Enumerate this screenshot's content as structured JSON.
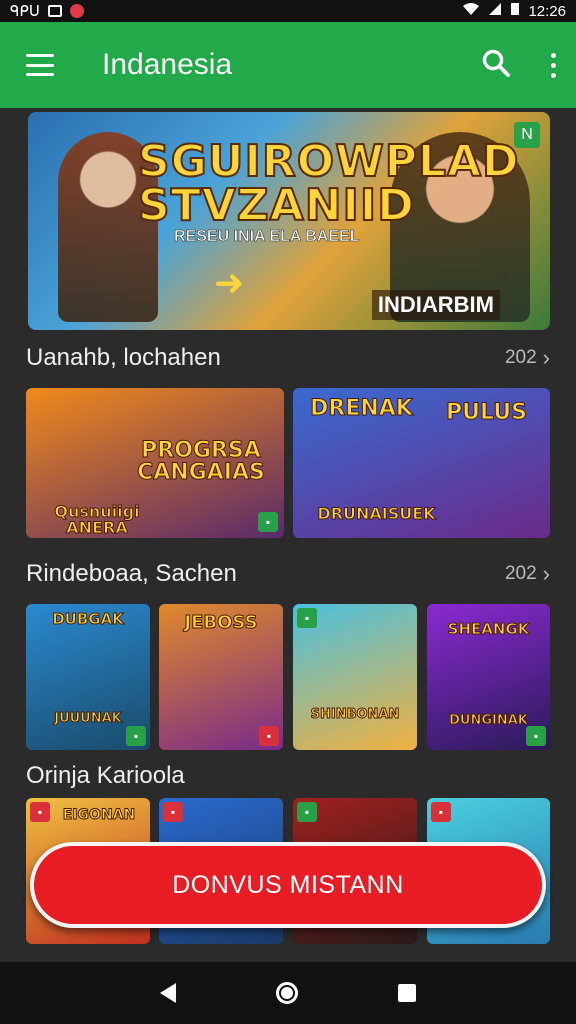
{
  "status": {
    "carrier": "ᑫᑭᑌ",
    "time": "12:26"
  },
  "app_bar": {
    "title": "Indanesia"
  },
  "banner": {
    "title_line1": "SGUIROWPLAD",
    "title_line2": "STVZANIID",
    "subtitle": "RESEU INIA ELA BAEEL",
    "tag": "INDIARBIM",
    "corner": "N"
  },
  "sections": [
    {
      "title": "Uanahb, lochahen",
      "count": "202",
      "cards": [
        {
          "label": "PROGRSA CANGAIAS",
          "bottom": "Qusnuiigi ANERA",
          "colors": [
            "#f08a1a",
            "#5a2a6a"
          ]
        },
        {
          "label": "DRENAK",
          "label2": "PULUS",
          "bottom": "DRUNAISUEK",
          "colors": [
            "#3a6ad0",
            "#6a2a8a"
          ]
        }
      ]
    },
    {
      "title": "Rindeboaa, Sachen",
      "count": "202",
      "cards": [
        {
          "label": "DUBGAK",
          "bottom": "JUUUNAK",
          "colors": [
            "#2a8ad0",
            "#1a4a6a"
          ]
        },
        {
          "label": "JEBOSS",
          "bottom": "",
          "colors": [
            "#e08a2a",
            "#7a2a8a"
          ]
        },
        {
          "label": "SHINBONAN",
          "bottom": "",
          "colors": [
            "#4ac0e0",
            "#f0b040"
          ]
        },
        {
          "label": "SHEANGK",
          "bottom": "DUNGINAK",
          "colors": [
            "#8a2ad0",
            "#2a1a5a"
          ]
        }
      ]
    },
    {
      "title": "Orinja Karioola",
      "count": "",
      "cards": [
        {
          "label": "EIGONAN",
          "colors": [
            "#f0c040",
            "#c03020"
          ]
        },
        {
          "label": "",
          "colors": [
            "#2a6ad0",
            "#1a3a6a"
          ]
        },
        {
          "label": "",
          "colors": [
            "#a02020",
            "#2a1a1a"
          ]
        },
        {
          "label": "",
          "colors": [
            "#4ad0e0",
            "#2a7ab0"
          ]
        }
      ]
    }
  ],
  "cta": {
    "label": "DONVUS MISTANN"
  },
  "colors": {
    "app_bar": "#22a94a",
    "cta": "#e81c24"
  }
}
